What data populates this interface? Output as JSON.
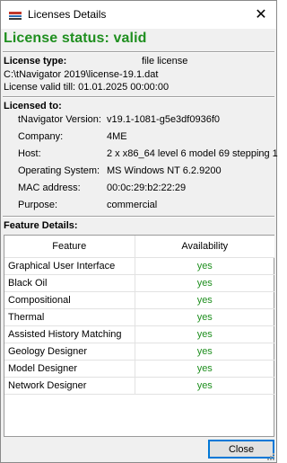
{
  "window": {
    "title": "Licenses Details",
    "icon": "app-logo-icon",
    "close_glyph": "✕"
  },
  "license": {
    "status": "License status: valid",
    "type_label": "License type:",
    "type_value": "file license",
    "path": "C:\\tNavigator 2019\\license-19.1.dat",
    "valid_till": "License valid till: 01.01.2025 00:00:00"
  },
  "licensed_to": {
    "heading": "Licensed to:",
    "rows": [
      {
        "label": "tNavigator Version:",
        "value": "v19.1-1081-g5e3df0936f0"
      },
      {
        "label": "Company:",
        "value": "4ME"
      },
      {
        "label": "Host:",
        "value": "2 x x86_64 level 6 model 69 stepping 1"
      },
      {
        "label": "Operating System:",
        "value": "MS Windows NT 6.2.9200"
      },
      {
        "label": "MAC address:",
        "value": "00:0c:29:b2:22:29"
      },
      {
        "label": "Purpose:",
        "value": "commercial"
      }
    ]
  },
  "features": {
    "heading": "Feature Details:",
    "columns": [
      "Feature",
      "Availability"
    ],
    "rows": [
      {
        "name": "Graphical User Interface",
        "availability": "yes"
      },
      {
        "name": "Black Oil",
        "availability": "yes"
      },
      {
        "name": "Compositional",
        "availability": "yes"
      },
      {
        "name": "Thermal",
        "availability": "yes"
      },
      {
        "name": "Assisted History Matching",
        "availability": "yes"
      },
      {
        "name": "Geology Designer",
        "availability": "yes"
      },
      {
        "name": "Model Designer",
        "availability": "yes"
      },
      {
        "name": "Network Designer",
        "availability": "yes"
      }
    ]
  },
  "buttons": {
    "close_label": "Close"
  },
  "colors": {
    "valid_green": "#1f8f1f",
    "focus_blue": "#0078d7"
  }
}
